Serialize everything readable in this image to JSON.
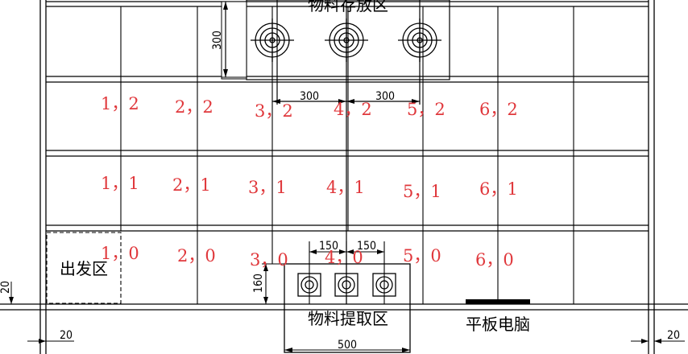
{
  "zones": {
    "storage_label": "物料存放区",
    "pickup_label": "物料提取区",
    "start_label": "出发区",
    "tablet_label": "平板电脑"
  },
  "dimensions": {
    "storage_height": "300",
    "storage_gap_left": "300",
    "storage_gap_right": "300",
    "pickup_gap_left": "150",
    "pickup_gap_right": "150",
    "pickup_height": "160",
    "pickup_width": "500",
    "left_margin_vertical": "20",
    "left_margin_horizontal": "20",
    "right_margin": "20"
  },
  "grid_labels": {
    "row2": [
      "1，2",
      "2，2",
      "3，2",
      "4，2",
      "5，2",
      "6，2"
    ],
    "row1": [
      "1，1",
      "2，1",
      "3，1",
      "4，1",
      "5，1",
      "6，1"
    ],
    "row0": [
      "1，0",
      "2，0",
      "3，0",
      "4，0",
      "5，0",
      "6，0"
    ]
  },
  "colors": {
    "line": "#000000",
    "coordinate_text": "#e0383c",
    "background": "#ffffff"
  }
}
